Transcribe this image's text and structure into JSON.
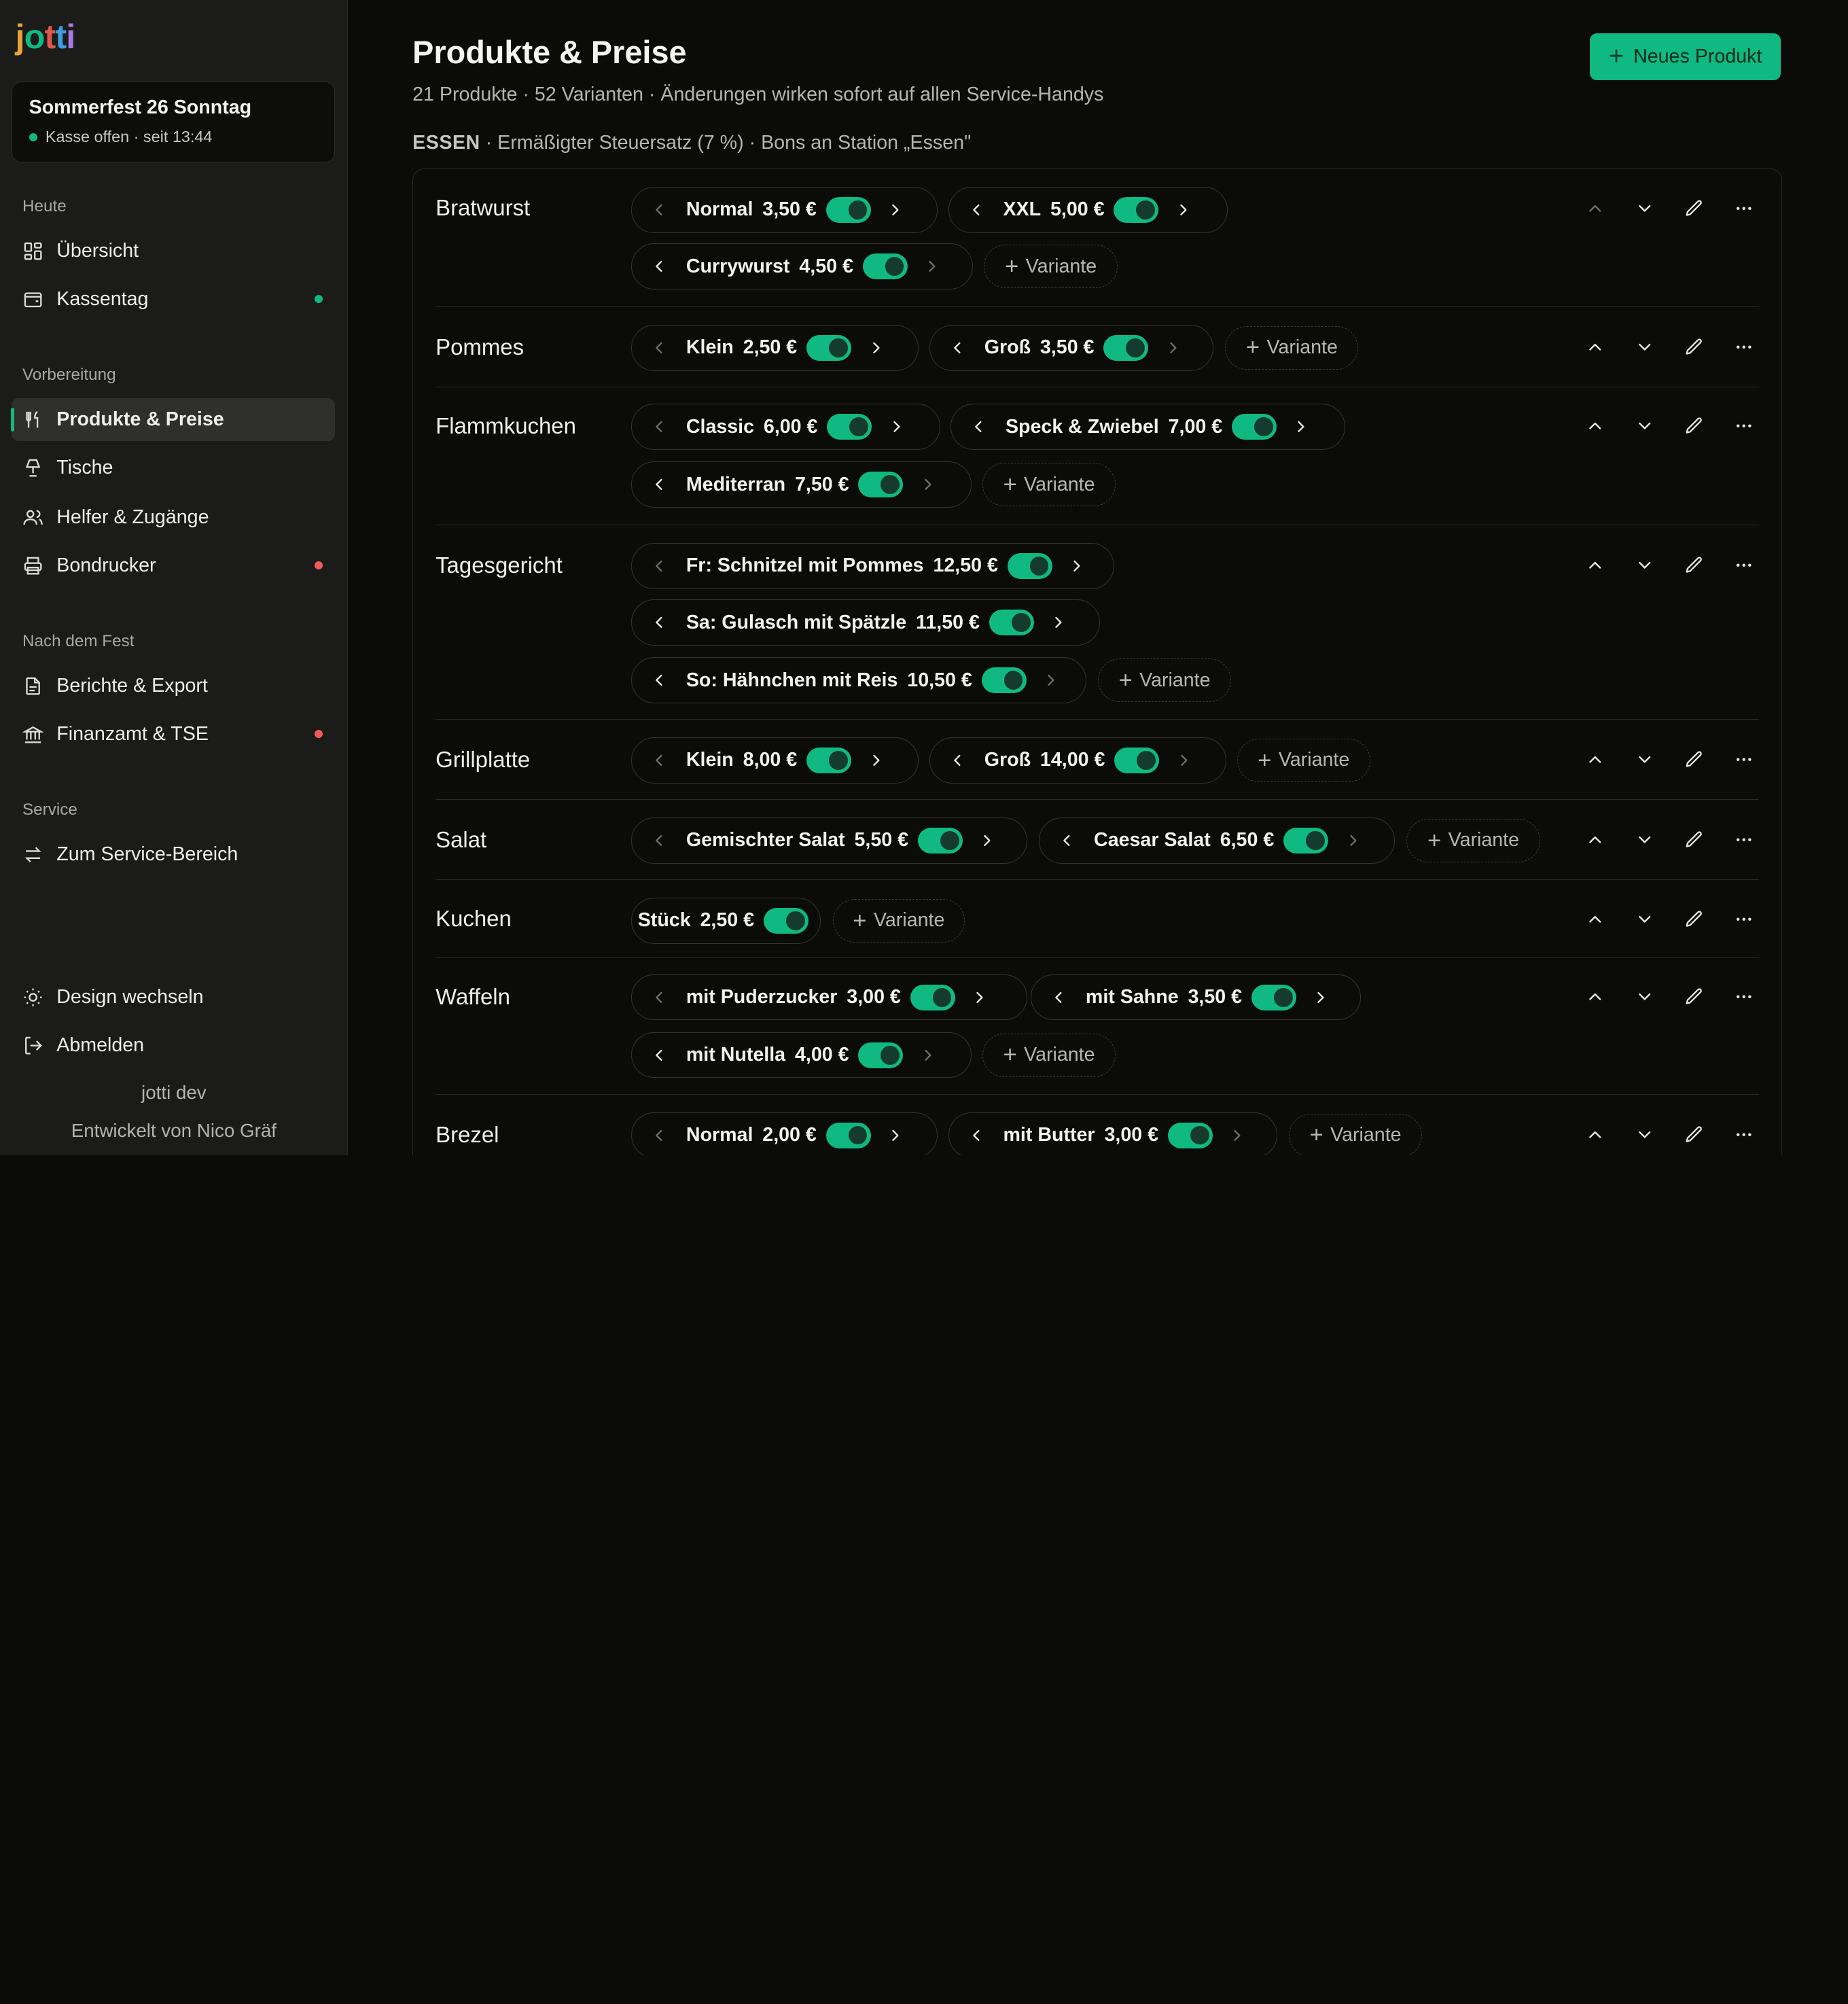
{
  "sidebar": {
    "logo": "jotti",
    "event": {
      "title": "Sommerfest 26 Sonntag",
      "status": "Kasse offen · seit 13:44"
    },
    "sections": {
      "heute": "Heute",
      "vorbereitung": "Vorbereitung",
      "nach_dem_fest": "Nach dem Fest",
      "service": "Service"
    },
    "items": {
      "uebersicht": "Übersicht",
      "kassentag": "Kassentag",
      "produkte": "Produkte & Preise",
      "tische": "Tische",
      "helfer": "Helfer & Zugänge",
      "bondrucker": "Bondrucker",
      "berichte": "Berichte & Export",
      "finanzamt": "Finanzamt & TSE",
      "service_bereich": "Zum Service-Bereich",
      "design": "Design wechseln",
      "abmelden": "Abmelden"
    },
    "footer": {
      "version": "jotti dev",
      "credit": "Entwickelt von Nico Gräf"
    }
  },
  "header": {
    "title": "Produkte & Preise",
    "subtitle": "21 Produkte · 52 Varianten · Änderungen wirken sofort auf allen Service-Handys",
    "new_button": "Neues Produkt"
  },
  "category": {
    "name": "ESSEN",
    "description": " · Ermäßigter Steuersatz (7 %) · Bons an Station „Essen\""
  },
  "add_variant_label": "Variante",
  "colors": {
    "accent": "#10b981",
    "alert": "#f05a5a",
    "background": "#0b0b0a",
    "sidebar": "#1b1b19"
  },
  "products": [
    {
      "name": "Bratwurst",
      "variants": [
        {
          "name": "Normal",
          "price": "3,50 €",
          "active": true
        },
        {
          "name": "XXL",
          "price": "5,00 €",
          "active": true
        },
        {
          "name": "Currywurst",
          "price": "4,50 €",
          "active": true
        }
      ]
    },
    {
      "name": "Pommes",
      "variants": [
        {
          "name": "Klein",
          "price": "2,50 €",
          "active": true
        },
        {
          "name": "Groß",
          "price": "3,50 €",
          "active": true
        }
      ]
    },
    {
      "name": "Flammkuchen",
      "variants": [
        {
          "name": "Classic",
          "price": "6,00 €",
          "active": true
        },
        {
          "name": "Speck & Zwiebel",
          "price": "7,00 €",
          "active": true
        },
        {
          "name": "Mediterran",
          "price": "7,50 €",
          "active": true
        }
      ]
    },
    {
      "name": "Tagesgericht",
      "variants": [
        {
          "name": "Fr: Schnitzel mit Pommes",
          "price": "12,50 €",
          "active": true
        },
        {
          "name": "Sa: Gulasch mit Spätzle",
          "price": "11,50 €",
          "active": true
        },
        {
          "name": "So: Hähnchen mit Reis",
          "price": "10,50 €",
          "active": true
        }
      ]
    },
    {
      "name": "Grillplatte",
      "variants": [
        {
          "name": "Klein",
          "price": "8,00 €",
          "active": true
        },
        {
          "name": "Groß",
          "price": "14,00 €",
          "active": true
        }
      ]
    },
    {
      "name": "Salat",
      "variants": [
        {
          "name": "Gemischter Salat",
          "price": "5,50 €",
          "active": true
        },
        {
          "name": "Caesar Salat",
          "price": "6,50 €",
          "active": true
        }
      ]
    },
    {
      "name": "Kuchen",
      "variants": [
        {
          "name": "Stück",
          "price": "2,50 €",
          "active": true
        }
      ]
    },
    {
      "name": "Waffeln",
      "variants": [
        {
          "name": "mit Puderzucker",
          "price": "3,00 €",
          "active": true
        },
        {
          "name": "mit Sahne",
          "price": "3,50 €",
          "active": true
        },
        {
          "name": "mit Nutella",
          "price": "4,00 €",
          "active": true
        }
      ]
    },
    {
      "name": "Brezel",
      "variants": [
        {
          "name": "Normal",
          "price": "2,00 €",
          "active": true
        },
        {
          "name": "mit Butter",
          "price": "3,00 €",
          "active": true
        }
      ]
    }
  ]
}
